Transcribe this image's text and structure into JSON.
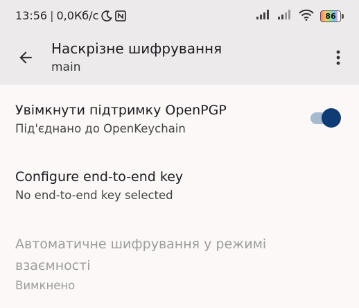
{
  "status_bar": {
    "time": "13:56",
    "separator": "|",
    "speed": "0,0Кб/с",
    "moon_icon": "moon-icon",
    "nfc_icon": "nfc-icon",
    "battery_level": "86"
  },
  "app_bar": {
    "back_icon": "arrow-back-icon",
    "title": "Наскрізне шифрування",
    "subtitle": "main",
    "menu_icon": "more-vert-icon"
  },
  "preferences": [
    {
      "title": "Увімкнути підтримку OpenPGP",
      "summary": "Під'єднано до OpenKeychain",
      "toggle_on": true
    },
    {
      "title": "Configure end-to-end key",
      "summary": "No end-to-end key selected"
    },
    {
      "title_line1": "Автоматичне шифрування у режимі",
      "title_line2": "взаємності",
      "summary": "Вимкнено",
      "enabled": false
    }
  ],
  "colors": {
    "accent": "#0f3c74",
    "toggle_track": "#a7b9cd",
    "app_bar_bg": "#eceaea",
    "disabled_text": "#9e9c9c"
  }
}
